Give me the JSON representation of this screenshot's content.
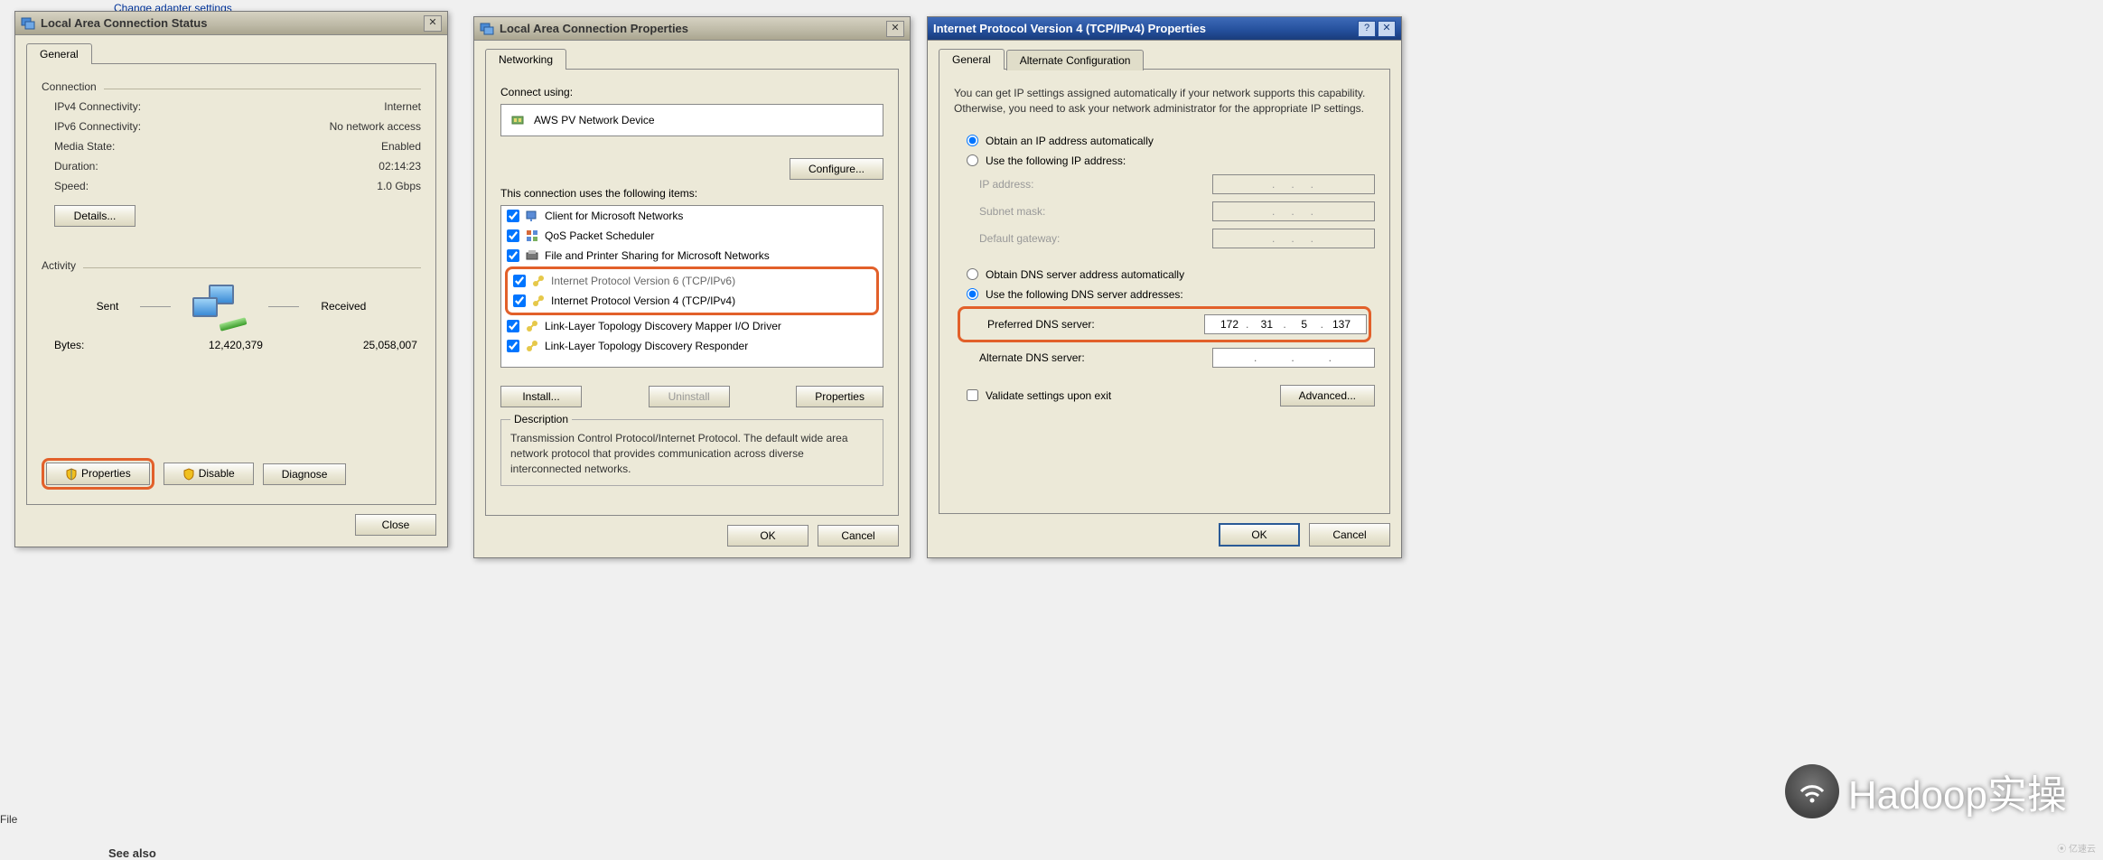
{
  "behind": {
    "link1": "Change adapter settings",
    "see_also": "See also",
    "ffile": "File"
  },
  "status": {
    "title": "Local Area Connection Status",
    "tab": "General",
    "group_connection": "Connection",
    "ipv4_label": "IPv4 Connectivity:",
    "ipv4_value": "Internet",
    "ipv6_label": "IPv6 Connectivity:",
    "ipv6_value": "No network access",
    "media_label": "Media State:",
    "media_value": "Enabled",
    "duration_label": "Duration:",
    "duration_value": "02:14:23",
    "speed_label": "Speed:",
    "speed_value": "1.0 Gbps",
    "details_btn": "Details...",
    "group_activity": "Activity",
    "sent": "Sent",
    "received": "Received",
    "bytes_label": "Bytes:",
    "bytes_sent": "12,420,379",
    "bytes_received": "25,058,007",
    "properties_btn": "Properties",
    "disable_btn": "Disable",
    "diagnose_btn": "Diagnose",
    "close_btn": "Close"
  },
  "props": {
    "title": "Local Area Connection Properties",
    "tab": "Networking",
    "connect_using": "Connect using:",
    "adapter": "AWS PV Network Device",
    "configure_btn": "Configure...",
    "items_label": "This connection uses the following items:",
    "items": [
      "Client for Microsoft Networks",
      "QoS Packet Scheduler",
      "File and Printer Sharing for Microsoft Networks",
      "Internet Protocol Version 6 (TCP/IPv6)",
      "Internet Protocol Version 4 (TCP/IPv4)",
      "Link-Layer Topology Discovery Mapper I/O Driver",
      "Link-Layer Topology Discovery Responder"
    ],
    "install_btn": "Install...",
    "uninstall_btn": "Uninstall",
    "properties_btn": "Properties",
    "desc_header": "Description",
    "desc_text": "Transmission Control Protocol/Internet Protocol. The default wide area network protocol that provides communication across diverse interconnected networks.",
    "ok_btn": "OK",
    "cancel_btn": "Cancel"
  },
  "ipv4": {
    "title": "Internet Protocol Version 4 (TCP/IPv4) Properties",
    "tab_general": "General",
    "tab_alt": "Alternate Configuration",
    "info": "You can get IP settings assigned automatically if your network supports this capability. Otherwise, you need to ask your network administrator for the appropriate IP settings.",
    "radio_auto_ip": "Obtain an IP address automatically",
    "radio_use_ip": "Use the following IP address:",
    "ip_label": "IP address:",
    "subnet_label": "Subnet mask:",
    "gateway_label": "Default gateway:",
    "radio_auto_dns": "Obtain DNS server address automatically",
    "radio_use_dns": "Use the following DNS server addresses:",
    "pref_dns_label": "Preferred DNS server:",
    "pref_dns_value": [
      "172",
      "31",
      "5",
      "137"
    ],
    "alt_dns_label": "Alternate DNS server:",
    "validate_label": "Validate settings upon exit",
    "advanced_btn": "Advanced...",
    "ok_btn": "OK",
    "cancel_btn": "Cancel"
  },
  "watermark": "Hadoop实操",
  "cc_logo": "亿速云"
}
